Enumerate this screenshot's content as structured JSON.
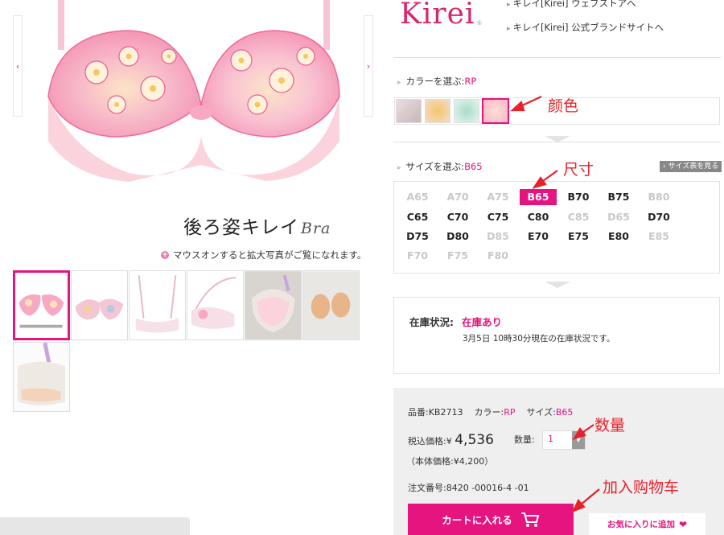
{
  "gallery": {
    "prev_label": "‹",
    "next_label": "›",
    "product_title": "後ろ姿キレイ",
    "product_title_script": "Bra",
    "zoom_hint": "マウスオンすると拡大写真がご覧になれます。",
    "thumbnails": [
      "thumb-1",
      "thumb-2",
      "thumb-3",
      "thumb-4",
      "thumb-5",
      "thumb-6",
      "thumb-7"
    ]
  },
  "brand": {
    "logo": "Kirei",
    "logo_mark": "®",
    "links": [
      "キレイ[Kirei] ウェブストアへ",
      "キレイ[Kirei] 公式ブランドサイトへ"
    ]
  },
  "color_section": {
    "label": "カラーを選ぶ:",
    "selected": "RP",
    "swatches": [
      {
        "name": "swatch-1",
        "color": "#d9c9c9"
      },
      {
        "name": "swatch-2",
        "color": "#f2dcc4"
      },
      {
        "name": "swatch-3",
        "color": "#d6eee4"
      },
      {
        "name": "swatch-4",
        "color": "#f8d3dc"
      }
    ]
  },
  "size_section": {
    "label": "サイズを選ぶ:",
    "selected": "B65",
    "chart_button": "サイズ表を見る",
    "rows": [
      [
        {
          "label": "A65",
          "state": "unavail"
        },
        {
          "label": "A70",
          "state": "unavail"
        },
        {
          "label": "A75",
          "state": "unavail"
        },
        {
          "label": "B65",
          "state": "selected"
        },
        {
          "label": "B70",
          "state": "avail"
        },
        {
          "label": "B75",
          "state": "avail"
        },
        {
          "label": "B80",
          "state": "unavail"
        }
      ],
      [
        {
          "label": "C65",
          "state": "avail"
        },
        {
          "label": "C70",
          "state": "avail"
        },
        {
          "label": "C75",
          "state": "avail"
        },
        {
          "label": "C80",
          "state": "avail"
        },
        {
          "label": "C85",
          "state": "unavail"
        },
        {
          "label": "D65",
          "state": "unavail"
        },
        {
          "label": "D70",
          "state": "avail"
        }
      ],
      [
        {
          "label": "D75",
          "state": "avail"
        },
        {
          "label": "D80",
          "state": "avail"
        },
        {
          "label": "D85",
          "state": "unavail"
        },
        {
          "label": "E70",
          "state": "avail"
        },
        {
          "label": "E75",
          "state": "avail"
        },
        {
          "label": "E80",
          "state": "avail"
        },
        {
          "label": "E85",
          "state": "unavail"
        }
      ],
      [
        {
          "label": "F70",
          "state": "unavail"
        },
        {
          "label": "F75",
          "state": "unavail"
        },
        {
          "label": "F80",
          "state": "unavail"
        }
      ]
    ]
  },
  "stock": {
    "label": "在庫状況:",
    "value": "在庫あり",
    "note": "3月5日 10時30分現在の在庫状況です。"
  },
  "order": {
    "product_no_label": "品番:",
    "product_no": "KB2713",
    "color_label": "カラー:",
    "color": "RP",
    "size_label": "サイズ:",
    "size": "B65",
    "price_label": "税込価格:",
    "currency": "¥",
    "price": "4,536",
    "qty_label": "数量:",
    "qty": "1",
    "qty_arrow": "▼",
    "base_price_text": "（本体価格:¥4,200）",
    "order_no_label": "注文番号:",
    "order_no": "8420 -00016-4 -01",
    "cart_button": "カートに入れる",
    "fav_button": "お気に入りに追加",
    "fav_heart": "❤"
  },
  "annotations": {
    "color": "颜色",
    "size": "尺寸",
    "quantity": "数量",
    "cart": "加入购物车"
  },
  "accent_color": "#e5147f",
  "annotation_color": "#e8202a"
}
